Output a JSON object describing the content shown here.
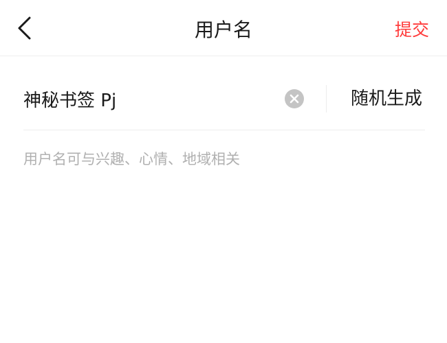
{
  "header": {
    "title": "用户名",
    "submit_label": "提交",
    "back_icon": "chevron-left-icon"
  },
  "username_field": {
    "value": "神秘书签 Pj",
    "clear_icon": "clear-circle-icon",
    "random_label": "随机生成"
  },
  "hint": "用户名可与兴趣、心情、地域相关",
  "colors": {
    "accent": "#ff3b3b",
    "text": "#1a1a1a",
    "hint": "#b0b0b0",
    "clear_icon_bg": "#c4c4c4",
    "divider": "#ececec"
  }
}
